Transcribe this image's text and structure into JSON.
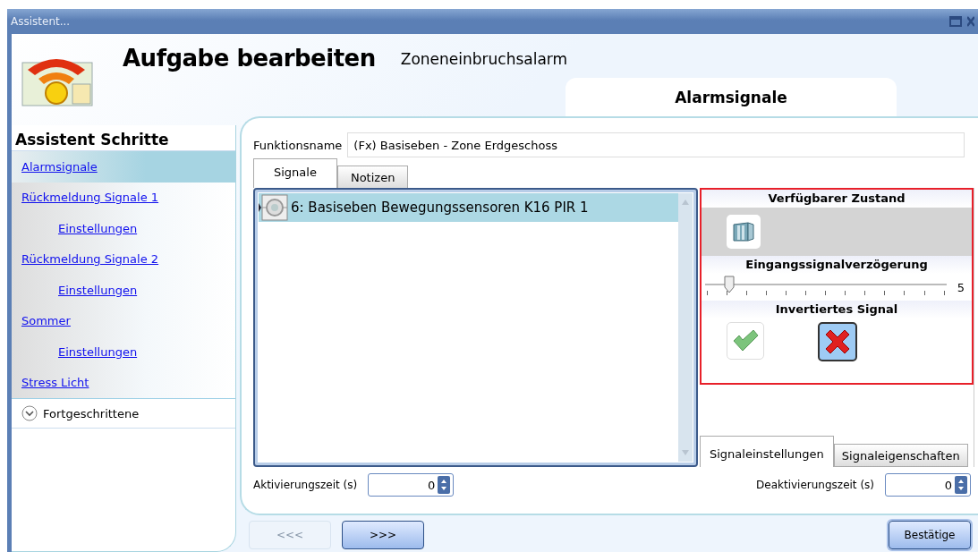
{
  "window": {
    "title": "Assistent..."
  },
  "header": {
    "title": "Aufgabe bearbeiten",
    "subtitle": "Zoneneinbruchsalarm",
    "step_title": "Alarmsignale"
  },
  "sidebar": {
    "heading": "Assistent Schritte",
    "items": [
      {
        "label": "Alarmsignale",
        "selected": true
      },
      {
        "label": "Rückmeldung Signale 1",
        "selected": false,
        "children": [
          {
            "label": "Einstellungen",
            "selected": false
          }
        ]
      },
      {
        "label": "Rückmeldung Signale 2",
        "selected": false,
        "children": [
          {
            "label": "Einstellungen",
            "selected": false
          }
        ]
      },
      {
        "label": "Sommer",
        "selected": false,
        "children": [
          {
            "label": "Einstellungen",
            "selected": false
          }
        ]
      },
      {
        "label": "Stress Licht",
        "selected": false
      }
    ],
    "advanced": {
      "label": "Fortgeschrittene",
      "expanded": false
    }
  },
  "function_name": {
    "label": "Funktionsname",
    "value": "(Fx) Basiseben - Zone Erdgeschoss"
  },
  "tabs": [
    {
      "label": "Signale",
      "selected": true
    },
    {
      "label": "Notizen",
      "selected": false
    }
  ],
  "signals": [
    {
      "label": "6: Basiseben Bewegungssensoren K16 PIR 1",
      "selected": true
    }
  ],
  "settings": {
    "state_heading": "Verfügbarer Zustand",
    "delay_heading": "Eingangssignalverzögerung",
    "delay": {
      "level": 0.1,
      "reading": "5"
    },
    "invert_heading": "Invertiertes Signal",
    "invert_options": [
      {
        "kind": "yes",
        "selected": false
      },
      {
        "kind": "no",
        "selected": true
      }
    ]
  },
  "settings_tabs": [
    {
      "label": "Signaleinstellungen",
      "selected": true
    },
    {
      "label": "Signaleigenschaften",
      "selected": false
    }
  ],
  "activation": {
    "label": "Aktivierungszeit (s)",
    "value": "0"
  },
  "deactivation": {
    "label": "Deaktivierungszeit (s)",
    "value": "0"
  },
  "nav_buttons": [
    {
      "label": "<<<",
      "disabled": true
    },
    {
      "label": ">>>",
      "disabled": false
    }
  ],
  "confirm_button": {
    "label": "Bestätige"
  }
}
